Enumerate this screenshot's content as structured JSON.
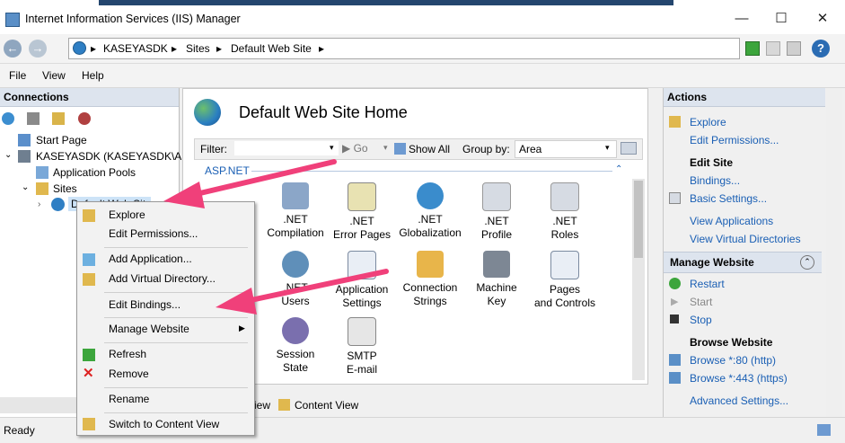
{
  "window": {
    "title": "Internet Information Services (IIS) Manager",
    "minimize": "—",
    "maximize": "☐",
    "close": "✕"
  },
  "address": {
    "back": "←",
    "forward": "→",
    "crumbs": [
      "KASEYASDK",
      "Sites",
      "Default Web Site"
    ],
    "separator": "▸",
    "help": "?"
  },
  "menu": {
    "items": [
      "File",
      "View",
      "Help"
    ]
  },
  "connections": {
    "title": "Connections",
    "tree": [
      {
        "label": "Start Page"
      },
      {
        "label": "KASEYASDK (KASEYASDK\\Adr"
      },
      {
        "label": "Application Pools"
      },
      {
        "label": "Sites"
      },
      {
        "label": "Default Web Site"
      }
    ]
  },
  "home": {
    "title": "Default Web Site Home",
    "filter_label": "Filter:",
    "go_label": "Go",
    "show_all_label": "Show All",
    "group_by_label": "Group by:",
    "group_by_value": "Area",
    "section": "ASP.NET",
    "features_row1": [
      ".NET Compilation",
      ".NET Error Pages",
      ".NET Globalization",
      ".NET Profile",
      ".NET Roles"
    ],
    "features_row2": [
      ".NET Users",
      "Application Settings",
      "Connection Strings",
      "Machine Key",
      "Pages and Controls"
    ],
    "features_row3": [
      "Session State",
      "SMTP E-mail"
    ],
    "view_tabs": {
      "features": "Features View",
      "content": "Content View"
    }
  },
  "actions": {
    "title": "Actions",
    "explore": "Explore",
    "edit_permissions": "Edit Permissions...",
    "edit_site": "Edit Site",
    "bindings": "Bindings...",
    "basic_settings": "Basic Settings...",
    "view_applications": "View Applications",
    "view_virtual_dirs": "View Virtual Directories",
    "manage_website": "Manage Website",
    "restart": "Restart",
    "start": "Start",
    "stop": "Stop",
    "browse_website": "Browse Website",
    "browse_80": "Browse *:80 (http)",
    "browse_443": "Browse *:443 (https)",
    "advanced_settings": "Advanced Settings..."
  },
  "context_menu": {
    "explore": "Explore",
    "edit_permissions": "Edit Permissions...",
    "add_application": "Add Application...",
    "add_virtual_directory": "Add Virtual Directory...",
    "edit_bindings": "Edit Bindings...",
    "manage_website": "Manage Website",
    "refresh": "Refresh",
    "remove": "Remove",
    "rename": "Rename",
    "switch_content_view": "Switch to Content View"
  },
  "status": {
    "text": "Ready"
  },
  "colors": {
    "arrow": "#f0407a",
    "link": "#1a5fb4",
    "panel_header": "#dde4ee"
  }
}
